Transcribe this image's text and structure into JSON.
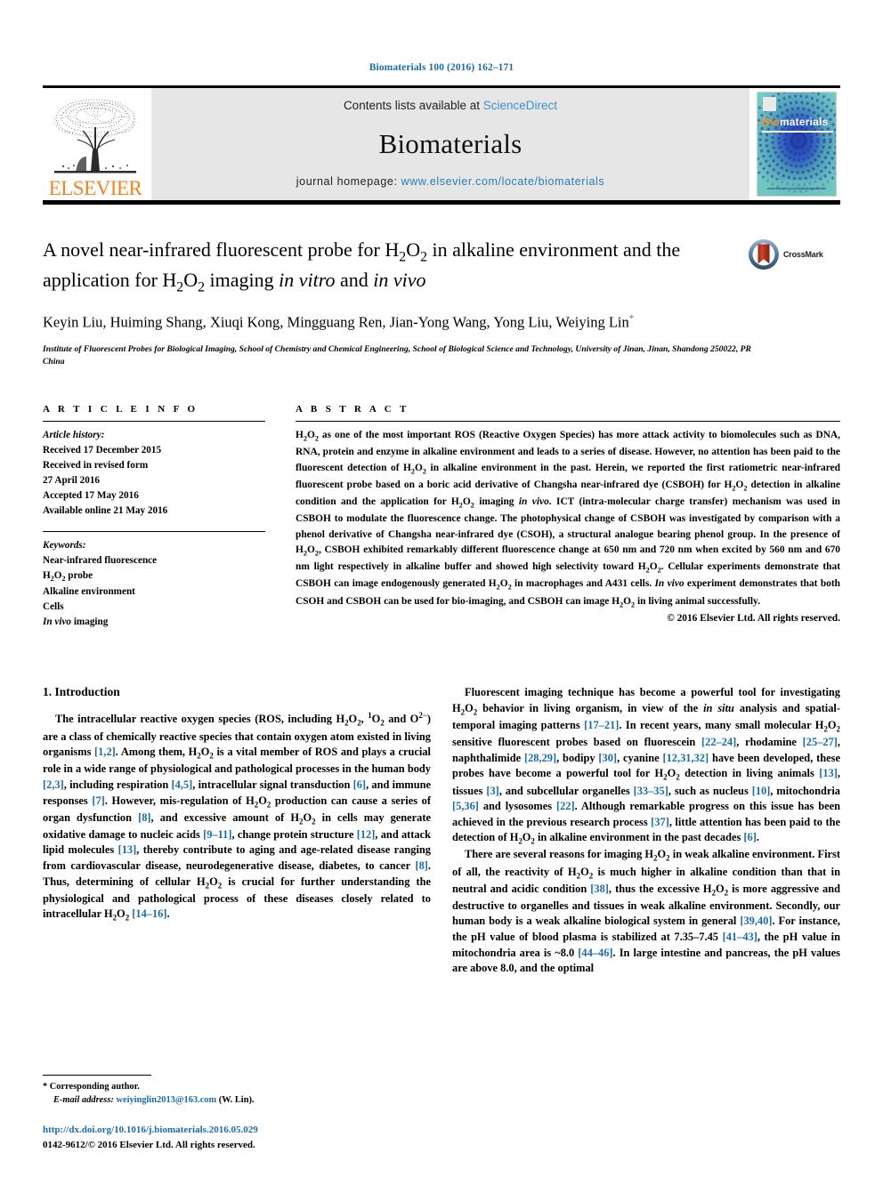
{
  "running_head": "Biomaterials 100 (2016) 162–171",
  "masthead": {
    "publisher_name": "ELSEVIER",
    "contents_prefix": "Contents lists available at ",
    "sciencedirect": "ScienceDirect",
    "journal_title": "Biomaterials",
    "homepage_label": "journal homepage: ",
    "homepage_url": "www.elsevier.com/locate/biomaterials",
    "cover_bio": "Bio",
    "cover_materials": "materials",
    "cover_footer": "www.elsevier.com/locate/biomaterials",
    "link_color": "#2a7cb8",
    "band_color": "#e6e6e6"
  },
  "article": {
    "title_line1": "A novel near-infrared fluorescent probe for H",
    "title_full": "A novel near-infrared fluorescent probe for H2O2 in alkaline environment and the application for H2O2 imaging in vitro and in vivo",
    "authors": "Keyin Liu, Huiming Shang, Xiuqi Kong, Mingguang Ren, Jian-Yong Wang, Yong Liu, Weiying Lin",
    "affiliation": "Institute of Fluorescent Probes for Biological Imaging, School of Chemistry and Chemical Engineering, School of Biological Science and Technology, University of Jinan, Jinan, Shandong 250022, PR China",
    "crossmark_label": "CrossMark"
  },
  "article_info": {
    "heading": "A R T I C L E   I N F O",
    "history_label": "Article history:",
    "history": [
      "Received 17 December 2015",
      "Received in revised form",
      "27 April 2016",
      "Accepted 17 May 2016",
      "Available online 21 May 2016"
    ],
    "keywords_label": "Keywords:",
    "keywords": [
      "Near-infrared fluorescence",
      "H2O2 probe",
      "Alkaline environment",
      "Cells",
      "In vivo imaging"
    ]
  },
  "abstract": {
    "heading": "A B S T R A C T",
    "text": "H2O2 as one of the most important ROS (Reactive Oxygen Species) has more attack activity to biomolecules such as DNA, RNA, protein and enzyme in alkaline environment and leads to a series of disease. However, no attention has been paid to the fluorescent detection of H2O2 in alkaline environment in the past. Herein, we reported the first ratiometric near-infrared fluorescent probe based on a boric acid derivative of Changsha near-infrared dye (CSBOH) for H2O2 detection in alkaline condition and the application for H2O2 imaging in vivo. ICT (intra-molecular charge transfer) mechanism was used in CSBOH to modulate the fluorescence change. The photophysical change of CSBOH was investigated by comparison with a phenol derivative of Changsha near-infrared dye (CSOH), a structural analogue bearing phenol group. In the presence of H2O2, CSBOH exhibited remarkably different fluorescence change at 650 nm and 720 nm when excited by 560 nm and 670 nm light respectively in alkaline buffer and showed high selectivity toward H2O2. Cellular experiments demonstrate that CSBOH can image endogenously generated H2O2 in macrophages and A431 cells. In vivo experiment demonstrates that both CSOH and CSBOH can be used for bio-imaging, and CSBOH can image H2O2 in living animal successfully.",
    "copyright": "© 2016 Elsevier Ltd. All rights reserved."
  },
  "introduction": {
    "section_number_title": "1.  Introduction",
    "left_paragraph_1": "The intracellular reactive oxygen species (ROS, including H2O2, 1O2 and O2−) are a class of chemically reactive species that contain oxygen atom existed in living organisms [1,2]. Among them, H2O2 is a vital member of ROS and plays a crucial role in a wide range of physiological and pathological processes in the human body [2,3], including respiration [4,5], intracellular signal transduction [6], and immune responses [7]. However, mis-regulation of H2O2 production can cause a series of organ dysfunction [8], and excessive amount of H2O2 in cells may generate oxidative damage to nucleic acids [9–11], change protein structure [12], and attack lipid molecules [13], thereby contribute to aging and age-related disease ranging from cardiovascular disease, neurodegenerative disease, diabetes, to cancer [8]. Thus, determining of cellular H2O2 is crucial for further understanding the physiological and pathological process of these diseases closely related to intracellular H2O2 [14–16].",
    "right_paragraph_1": "Fluorescent imaging technique has become a powerful tool for investigating H2O2 behavior in living organism, in view of the in situ analysis and spatial-temporal imaging patterns [17–21]. In recent years, many small molecular H2O2 sensitive fluorescent probes based on fluorescein [22–24], rhodamine [25–27], naphthalimide [28,29], bodipy [30], cyanine [12,31,32] have been developed, these probes have become a powerful tool for H2O2 detection in living animals [13], tissues [3], and subcellular organelles [33–35], such as nucleus [10], mitochondria [5,36] and lysosomes [22]. Although remarkable progress on this issue has been achieved in the previous research process [37], little attention has been paid to the detection of H2O2 in alkaline environment in the past decades [6].",
    "right_paragraph_2": "There are several reasons for imaging H2O2 in weak alkaline environment. First of all, the reactivity of H2O2 is much higher in alkaline condition than that in neutral and acidic condition [38], thus the excessive H2O2 is more aggressive and destructive to organelles and tissues in weak alkaline environment. Secondly, our human body is a weak alkaline biological system in general [39,40]. For instance, the pH value of blood plasma is stabilized at 7.35–7.45 [41–43], the pH value in mitochondria area is ~8.0 [44–46]. In large intestine and pancreas, the pH values are above 8.0, and the optimal"
  },
  "footer": {
    "corresponding_label": "Corresponding author.",
    "email_label": "E-mail address:",
    "email": "weiyinglin2013@163.com",
    "email_suffix": "(W. Lin).",
    "doi": "http://dx.doi.org/10.1016/j.biomaterials.2016.05.029",
    "issn_line": "0142-9612/© 2016 Elsevier Ltd. All rights reserved."
  }
}
